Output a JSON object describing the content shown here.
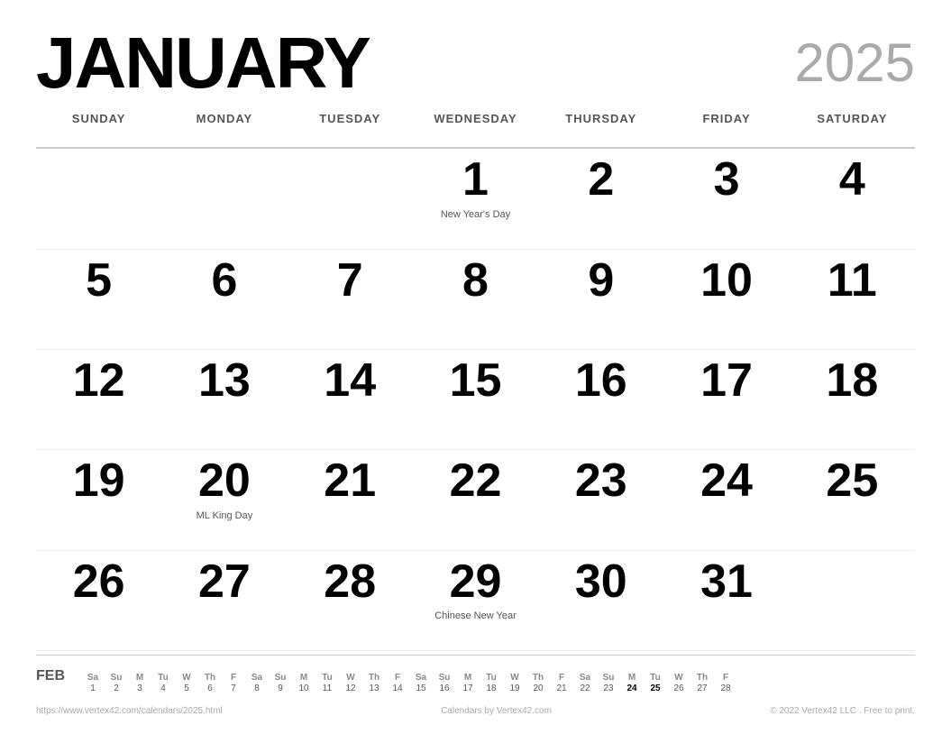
{
  "header": {
    "month": "JANUARY",
    "year": "2025"
  },
  "day_headers": [
    "SUNDAY",
    "MONDAY",
    "TUESDAY",
    "WEDNESDAY",
    "THURSDAY",
    "FRIDAY",
    "SATURDAY"
  ],
  "weeks": [
    [
      {
        "day": "",
        "event": ""
      },
      {
        "day": "",
        "event": ""
      },
      {
        "day": "",
        "event": ""
      },
      {
        "day": "1",
        "event": "New Year's Day"
      },
      {
        "day": "2",
        "event": ""
      },
      {
        "day": "3",
        "event": ""
      },
      {
        "day": "4",
        "event": ""
      }
    ],
    [
      {
        "day": "5",
        "event": ""
      },
      {
        "day": "6",
        "event": ""
      },
      {
        "day": "7",
        "event": ""
      },
      {
        "day": "8",
        "event": ""
      },
      {
        "day": "9",
        "event": ""
      },
      {
        "day": "10",
        "event": ""
      },
      {
        "day": "11",
        "event": ""
      }
    ],
    [
      {
        "day": "12",
        "event": ""
      },
      {
        "day": "13",
        "event": ""
      },
      {
        "day": "14",
        "event": ""
      },
      {
        "day": "15",
        "event": ""
      },
      {
        "day": "16",
        "event": ""
      },
      {
        "day": "17",
        "event": ""
      },
      {
        "day": "18",
        "event": ""
      }
    ],
    [
      {
        "day": "19",
        "event": ""
      },
      {
        "day": "20",
        "event": "ML King Day"
      },
      {
        "day": "21",
        "event": ""
      },
      {
        "day": "22",
        "event": ""
      },
      {
        "day": "23",
        "event": ""
      },
      {
        "day": "24",
        "event": ""
      },
      {
        "day": "25",
        "event": ""
      }
    ],
    [
      {
        "day": "26",
        "event": ""
      },
      {
        "day": "27",
        "event": ""
      },
      {
        "day": "28",
        "event": ""
      },
      {
        "day": "29",
        "event": "Chinese New Year"
      },
      {
        "day": "30",
        "event": ""
      },
      {
        "day": "31",
        "event": ""
      },
      {
        "day": "",
        "event": ""
      }
    ]
  ],
  "mini_calendar": {
    "month_label": "FEB",
    "col_headers": [
      "Sa",
      "Su",
      "M",
      "Tu",
      "W",
      "Th",
      "F",
      "Sa",
      "Su",
      "M",
      "Tu",
      "W",
      "Th",
      "F",
      "Sa",
      "Su",
      "M",
      "Tu",
      "W",
      "Th",
      "F",
      "Sa",
      "Su",
      "M",
      "Tu",
      "W",
      "Th",
      "F"
    ],
    "row_values": [
      "1",
      "2",
      "3",
      "4",
      "5",
      "6",
      "7",
      "8",
      "9",
      "10",
      "11",
      "12",
      "13",
      "14",
      "15",
      "16",
      "17",
      "18",
      "19",
      "20",
      "21",
      "22",
      "23",
      "24",
      "25",
      "26",
      "27",
      "28"
    ],
    "bold_days": [
      "24",
      "25"
    ]
  },
  "attribution": {
    "left": "https://www.vertex42.com/calendars/2025.html",
    "center": "Calendars by Vertex42.com",
    "right": "© 2022 Vertex42 LLC . Free to print."
  }
}
